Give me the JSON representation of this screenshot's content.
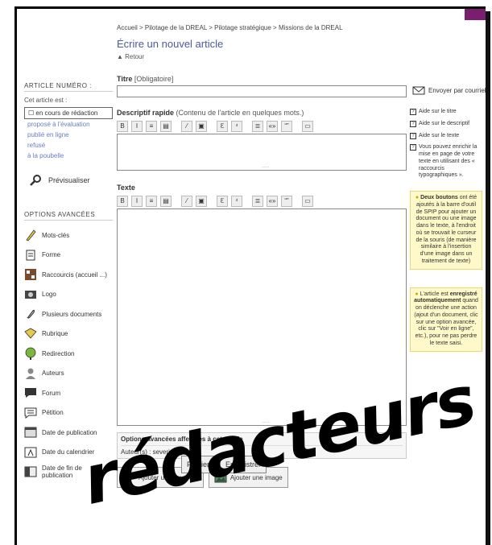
{
  "breadcrumb": "Accueil > Pilotage de la DREAL > Pilotage stratégique > Missions de la DREAL",
  "page_title": "Écrire un nouvel article",
  "back_link": "Retour",
  "title_field": {
    "label": "Titre",
    "hint": "[Obligatoire]",
    "value": ""
  },
  "desc_field": {
    "label": "Descriptif rapide",
    "hint": "(Contenu de l'article en quelques mots.)"
  },
  "text_field": {
    "label": "Texte"
  },
  "toolbar_labels": [
    "B",
    "I",
    "≡",
    "▤",
    "⁄",
    "▣",
    "ℇ",
    "⁴",
    "≣",
    "«»",
    "“”",
    "▭"
  ],
  "advanced_box": {
    "title": "Options avancées affectées à cet article",
    "authors": "Auteur(s) : severine.gabet |"
  },
  "doc_buttons": {
    "add_doc": "Ajouter un document",
    "add_image": "Ajouter une image"
  },
  "submit_buttons": {
    "publish": "Publier",
    "save": "Enregistrer"
  },
  "left": {
    "article_number": "ARTICLE NUMÉRO :",
    "status_label": "Cet article est :",
    "statuses": [
      "en cours de rédaction",
      "proposé à l'évaluation",
      "publié en ligne",
      "refusé",
      "à la poubelle"
    ],
    "preview": "Prévisualiser",
    "advanced_title": "OPTIONS AVANCÉES",
    "options": [
      "Mots-clés",
      "Forme",
      "Raccourcis (accueil ...)",
      "Logo",
      "Plusieurs documents",
      "Rubrique",
      "Redirection",
      "Auteurs",
      "Forum",
      "Pétition",
      "Date de publication",
      "Date du calendrier",
      "Date de fin de publication"
    ]
  },
  "right": {
    "mail": "Envoyer par courriel",
    "help": [
      "Aide sur le titre",
      "Aide sur le descriptif",
      "Aide sur le texte",
      "Vous pouvez enrichir la mise en page de votre texte en utilisant des « raccourcis typographiques »."
    ],
    "tip1_bold": "Deux boutons",
    "tip1_text": " ont été ajoutés à la barre d'outil de SPIP pour ajouter un document ou une image dans le texte, à l'endroit où se trouvait le curseur de la souris (de manière similaire à l'insertion d'une image dans un traitement de texte)",
    "tip2_pre": "L'article est ",
    "tip2_bold": "enregistré automatiquement",
    "tip2_text": " quand on déclenche une action (ajout d'un document, clic sur une option avancée, clic sur \"Voir en ligne\", etc.), pour ne pas perdre le texte saisi."
  },
  "overlay_text": "rédacteurs",
  "colors": {
    "link": "#6a7dc4",
    "title": "#4a5a9a",
    "tip_bg": "#fff9c9",
    "corner": "#7a1f6f"
  }
}
